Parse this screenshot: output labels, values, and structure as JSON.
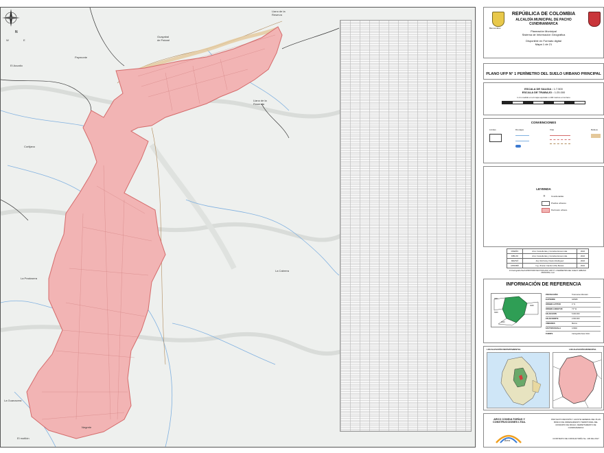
{
  "map": {
    "places": [
      {
        "id": "llano-reserva",
        "text": "Llano de la Reserva"
      },
      {
        "id": "guayabal",
        "text": "Guayabal de Patoné"
      },
      {
        "id": "paymonte",
        "text": "Paymonte"
      },
      {
        "id": "el-acuatio",
        "text": "El Acuatio"
      },
      {
        "id": "llano-rosenda",
        "text": "Llano de la Rosenda"
      },
      {
        "id": "cortijano",
        "text": "Cortijano"
      },
      {
        "id": "la-cabrera",
        "text": "La Cabrera"
      },
      {
        "id": "la-pradosera",
        "text": "La Pradosera"
      },
      {
        "id": "la-guanacera",
        "text": "La Guanacera"
      },
      {
        "id": "negrete",
        "text": "Negrete"
      },
      {
        "id": "el-motilon",
        "text": "El motilón"
      }
    ],
    "compass": {
      "n": "N",
      "s": "S",
      "e": "E",
      "w": "W"
    },
    "colors": {
      "urban_fill": "#f2b4b4",
      "urban_stroke": "#d46a6a",
      "river": "#7fb0e0",
      "terrain": "#eef0ee",
      "boundary": "#555555"
    }
  },
  "header": {
    "republic": "REPÚBLICA DE COLOMBIA",
    "alcaldia": "ALCALDÍA MUNICIPAL DE PACHO",
    "dept": "CUNDINAMARCA",
    "sub1": "Planeación Municipal",
    "sub2": "Sistema de Información Geográfica",
    "sub3": "Disponible en Formato digital",
    "map_num": "Mapa 1 de 21",
    "logo_text": "Bienvenidos"
  },
  "plan_title": "PLANO UFP N° 1  PERÍMETRO DEL SUELO URBANO PRINCIPAL",
  "scale": {
    "salida_label": "ESCALA DE SALIDA :",
    "salida": "1:7.500",
    "trabajo_label": "ESCALA DE TRABAJO :",
    "trabajo": "1:25.000",
    "note": "1 cm medido en el mapa equivale a 100 metros en terreno"
  },
  "convenciones": {
    "title": "CONVENCIONES",
    "col1": "Límites",
    "col2": "Drenajes",
    "col3": "Vías",
    "col4": "Relieve"
  },
  "leyenda": {
    "title": "LEYENDA",
    "items": [
      "Coordenadas",
      "Predios urbanos",
      "Perímetro urbano"
    ]
  },
  "credits": [
    [
      "DISEÑO",
      "Arco Consultorías y Construcciones Ltda.",
      "2022"
    ],
    [
      "DIBUJO",
      "Arco Consultorías y Construcciones Ltda.",
      "2022"
    ],
    [
      "REVISÓ",
      "Arq. Ruth Amy Osorio Rodríguez",
      "2022"
    ],
    [
      "APROBÓ",
      "Ing. Jhonier Camilo Uribe Bustos",
      "2022"
    ]
  ],
  "file_path": "D:\\Cartografía Pacho\\PBOT\\PROYECTO\\PLANO UFP N° 1 PERÍMETRO DEL SUELO URBANO PRINCIPAL.mxd",
  "ref": {
    "title": "INFORMACIÓN DE REFERENCIA",
    "rows": [
      [
        "PROYECCIÓN",
        "Transverse Mercator"
      ],
      [
        "ELIPSOIDE",
        "GRS80"
      ],
      [
        "ORIGEN LATITUD",
        "4° N"
      ],
      [
        "ORIGEN LONGITUD",
        "73° W"
      ],
      [
        "FALSO ESTE",
        "5.000.000"
      ],
      [
        "FALSO NORTE",
        "2.000.000"
      ],
      [
        "UNIDADES",
        "Metros"
      ],
      [
        "FACTOR ESCALA",
        "0,9992"
      ],
      [
        "FUENTE",
        "Cartografía base IGAC"
      ]
    ],
    "tiles": [
      "3007",
      "3008",
      "3009",
      "3010"
    ]
  },
  "location": {
    "dept_title": "LOCALIZACIÓN DEPARTAMENTAL",
    "mun_title": "LOCALIZACIÓN MUNICIPAL"
  },
  "footer": {
    "company": "ARCO CONSULTORÍAS Y CONSTRUCCIONES LTDA.",
    "project": "PROYECTO REVISIÓN Y AJUSTE GENERAL DEL PLAN BÁSICO DE ORDENAMIENTO TERRITORIAL DEL MUNICIPIO DE PACHO, DEPARTAMENTO DE CUNDINAMARCA",
    "contract": "CONTRATO DE CONSULTORÍA No. 133 DE 2017",
    "logo": "Arco"
  }
}
